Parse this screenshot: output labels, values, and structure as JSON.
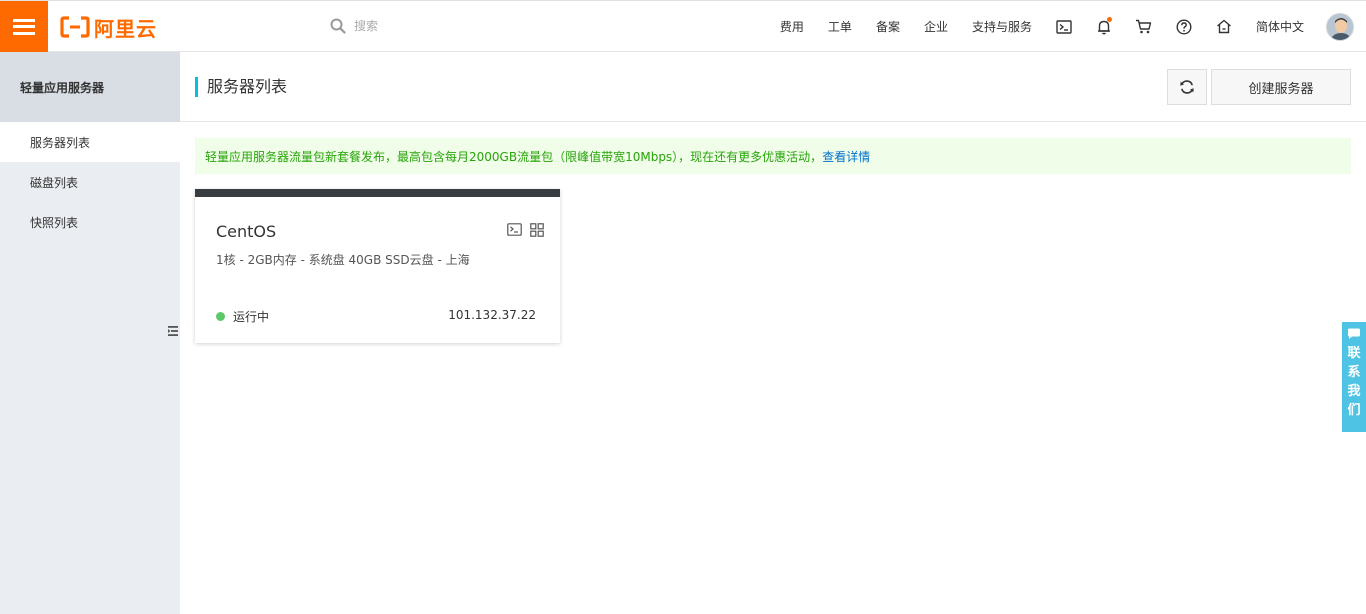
{
  "header": {
    "logo_text": "阿里云",
    "search_placeholder": "搜索",
    "nav": [
      "费用",
      "工单",
      "备案",
      "企业",
      "支持与服务"
    ],
    "language": "简体中文",
    "icons": [
      "terminal-icon",
      "bell-icon",
      "cart-icon",
      "help-icon",
      "home-icon"
    ],
    "accent_color": "#ff6a00"
  },
  "sidebar": {
    "title": "轻量应用服务器",
    "items": [
      {
        "label": "服务器列表",
        "active": true
      },
      {
        "label": "磁盘列表",
        "active": false
      },
      {
        "label": "快照列表",
        "active": false
      }
    ]
  },
  "main": {
    "title": "服务器列表",
    "create_label": "创建服务器",
    "notice_text": "轻量应用服务器流量包新套餐发布，最高包含每月2000GB流量包（限峰值带宽10Mbps），现在还有更多优惠活动，",
    "notice_link": "查看详情",
    "notice_color": "#28a40a"
  },
  "server": {
    "os": "CentOS",
    "spec": "1核 - 2GB内存 - 系统盘 40GB SSD云盘 - 上海",
    "status": "运行中",
    "status_color": "#5bc96a",
    "ip": "101.132.37.22"
  },
  "contact": {
    "chars": [
      "联",
      "系",
      "我",
      "们"
    ],
    "color": "#4fc3e3"
  }
}
